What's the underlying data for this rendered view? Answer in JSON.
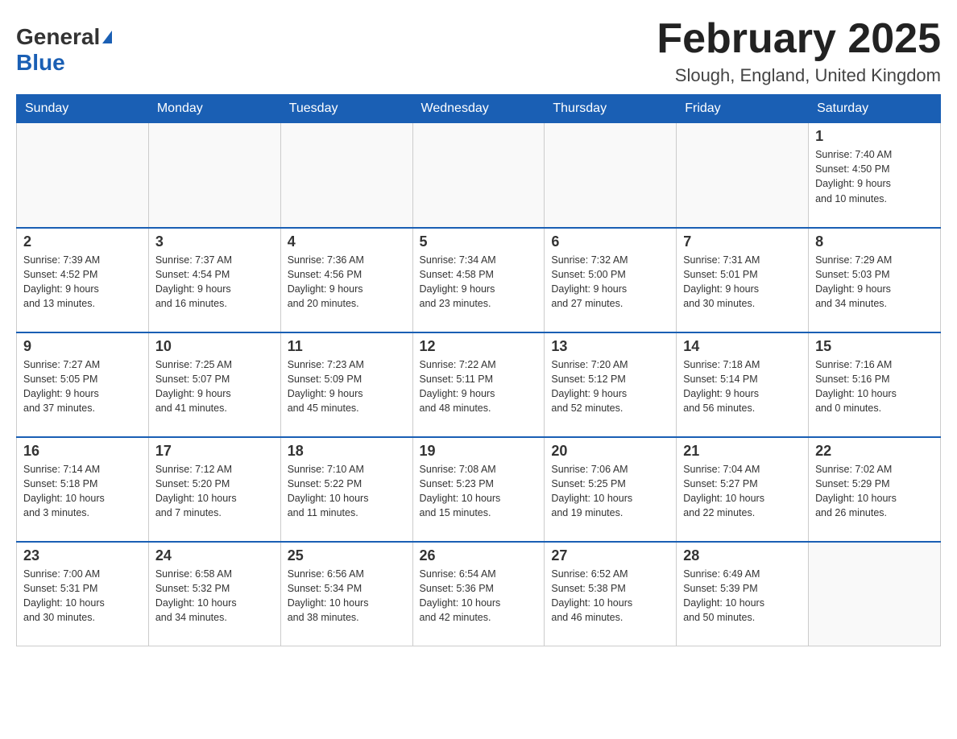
{
  "header": {
    "logo_general": "General",
    "logo_blue": "Blue",
    "month_title": "February 2025",
    "location": "Slough, England, United Kingdom"
  },
  "days_of_week": [
    "Sunday",
    "Monday",
    "Tuesday",
    "Wednesday",
    "Thursday",
    "Friday",
    "Saturday"
  ],
  "weeks": [
    [
      {
        "day": "",
        "info": ""
      },
      {
        "day": "",
        "info": ""
      },
      {
        "day": "",
        "info": ""
      },
      {
        "day": "",
        "info": ""
      },
      {
        "day": "",
        "info": ""
      },
      {
        "day": "",
        "info": ""
      },
      {
        "day": "1",
        "info": "Sunrise: 7:40 AM\nSunset: 4:50 PM\nDaylight: 9 hours\nand 10 minutes."
      }
    ],
    [
      {
        "day": "2",
        "info": "Sunrise: 7:39 AM\nSunset: 4:52 PM\nDaylight: 9 hours\nand 13 minutes."
      },
      {
        "day": "3",
        "info": "Sunrise: 7:37 AM\nSunset: 4:54 PM\nDaylight: 9 hours\nand 16 minutes."
      },
      {
        "day": "4",
        "info": "Sunrise: 7:36 AM\nSunset: 4:56 PM\nDaylight: 9 hours\nand 20 minutes."
      },
      {
        "day": "5",
        "info": "Sunrise: 7:34 AM\nSunset: 4:58 PM\nDaylight: 9 hours\nand 23 minutes."
      },
      {
        "day": "6",
        "info": "Sunrise: 7:32 AM\nSunset: 5:00 PM\nDaylight: 9 hours\nand 27 minutes."
      },
      {
        "day": "7",
        "info": "Sunrise: 7:31 AM\nSunset: 5:01 PM\nDaylight: 9 hours\nand 30 minutes."
      },
      {
        "day": "8",
        "info": "Sunrise: 7:29 AM\nSunset: 5:03 PM\nDaylight: 9 hours\nand 34 minutes."
      }
    ],
    [
      {
        "day": "9",
        "info": "Sunrise: 7:27 AM\nSunset: 5:05 PM\nDaylight: 9 hours\nand 37 minutes."
      },
      {
        "day": "10",
        "info": "Sunrise: 7:25 AM\nSunset: 5:07 PM\nDaylight: 9 hours\nand 41 minutes."
      },
      {
        "day": "11",
        "info": "Sunrise: 7:23 AM\nSunset: 5:09 PM\nDaylight: 9 hours\nand 45 minutes."
      },
      {
        "day": "12",
        "info": "Sunrise: 7:22 AM\nSunset: 5:11 PM\nDaylight: 9 hours\nand 48 minutes."
      },
      {
        "day": "13",
        "info": "Sunrise: 7:20 AM\nSunset: 5:12 PM\nDaylight: 9 hours\nand 52 minutes."
      },
      {
        "day": "14",
        "info": "Sunrise: 7:18 AM\nSunset: 5:14 PM\nDaylight: 9 hours\nand 56 minutes."
      },
      {
        "day": "15",
        "info": "Sunrise: 7:16 AM\nSunset: 5:16 PM\nDaylight: 10 hours\nand 0 minutes."
      }
    ],
    [
      {
        "day": "16",
        "info": "Sunrise: 7:14 AM\nSunset: 5:18 PM\nDaylight: 10 hours\nand 3 minutes."
      },
      {
        "day": "17",
        "info": "Sunrise: 7:12 AM\nSunset: 5:20 PM\nDaylight: 10 hours\nand 7 minutes."
      },
      {
        "day": "18",
        "info": "Sunrise: 7:10 AM\nSunset: 5:22 PM\nDaylight: 10 hours\nand 11 minutes."
      },
      {
        "day": "19",
        "info": "Sunrise: 7:08 AM\nSunset: 5:23 PM\nDaylight: 10 hours\nand 15 minutes."
      },
      {
        "day": "20",
        "info": "Sunrise: 7:06 AM\nSunset: 5:25 PM\nDaylight: 10 hours\nand 19 minutes."
      },
      {
        "day": "21",
        "info": "Sunrise: 7:04 AM\nSunset: 5:27 PM\nDaylight: 10 hours\nand 22 minutes."
      },
      {
        "day": "22",
        "info": "Sunrise: 7:02 AM\nSunset: 5:29 PM\nDaylight: 10 hours\nand 26 minutes."
      }
    ],
    [
      {
        "day": "23",
        "info": "Sunrise: 7:00 AM\nSunset: 5:31 PM\nDaylight: 10 hours\nand 30 minutes."
      },
      {
        "day": "24",
        "info": "Sunrise: 6:58 AM\nSunset: 5:32 PM\nDaylight: 10 hours\nand 34 minutes."
      },
      {
        "day": "25",
        "info": "Sunrise: 6:56 AM\nSunset: 5:34 PM\nDaylight: 10 hours\nand 38 minutes."
      },
      {
        "day": "26",
        "info": "Sunrise: 6:54 AM\nSunset: 5:36 PM\nDaylight: 10 hours\nand 42 minutes."
      },
      {
        "day": "27",
        "info": "Sunrise: 6:52 AM\nSunset: 5:38 PM\nDaylight: 10 hours\nand 46 minutes."
      },
      {
        "day": "28",
        "info": "Sunrise: 6:49 AM\nSunset: 5:39 PM\nDaylight: 10 hours\nand 50 minutes."
      },
      {
        "day": "",
        "info": ""
      }
    ]
  ]
}
